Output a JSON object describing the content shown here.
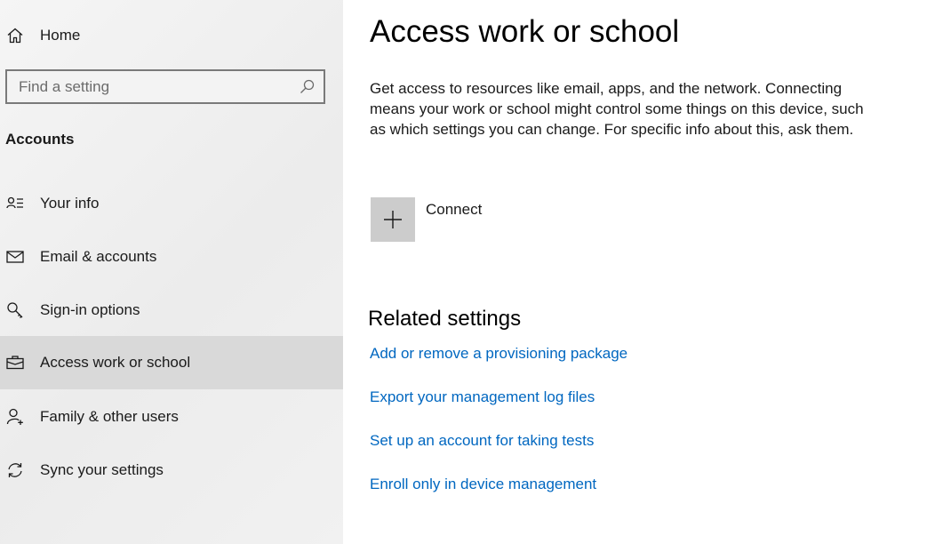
{
  "sidebar": {
    "home_label": "Home",
    "search_placeholder": "Find a setting",
    "section_title": "Accounts",
    "items": [
      {
        "label": "Your info",
        "icon": "user-info-icon",
        "selected": false
      },
      {
        "label": "Email & accounts",
        "icon": "mail-icon",
        "selected": false
      },
      {
        "label": "Sign-in options",
        "icon": "key-icon",
        "selected": false
      },
      {
        "label": "Access work or school",
        "icon": "briefcase-icon",
        "selected": true
      },
      {
        "label": "Family & other users",
        "icon": "add-user-icon",
        "selected": false
      },
      {
        "label": "Sync your settings",
        "icon": "sync-icon",
        "selected": false
      }
    ]
  },
  "main": {
    "title": "Access work or school",
    "description": "Get access to resources like email, apps, and the network. Connecting means your work or school might control some things on this device, such as which settings you can change. For specific info about this, ask them.",
    "connect_label": "Connect",
    "related": {
      "title": "Related settings",
      "links": [
        "Add or remove a provisioning package",
        "Export your management log files",
        "Set up an account for taking tests",
        "Enroll only in device management"
      ]
    }
  },
  "colors": {
    "link": "#0067c0",
    "selected_bg": "#d9d9d9",
    "sidebar_bg": "#f2f2f2",
    "connect_tile": "#cccccc"
  }
}
